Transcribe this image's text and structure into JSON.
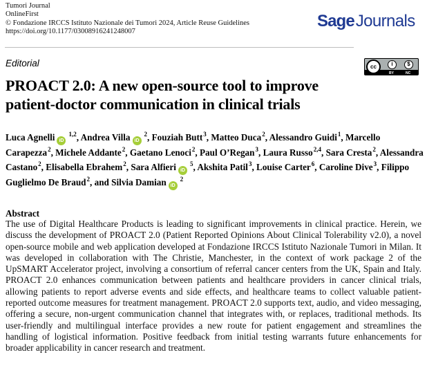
{
  "header": {
    "journal": "Tumori Journal",
    "status": "OnlineFirst",
    "copyright": "© Fondazione IRCCS Istituto Nazionale dei Tumori 2024, Article Reuse Guidelines",
    "doi": "https://doi.org/10.1177/03008916241248007",
    "brand_bold": "Sage",
    "brand_regular": "Journals",
    "brand_color": "#1f3a93"
  },
  "article": {
    "type": "Editorial",
    "license": {
      "icon": "cc-by-nc-icon",
      "cc": "cc",
      "by": "BY",
      "nc": "NC"
    },
    "title": "PROACT 2.0: A new open-source tool to improve patient-doctor communication in clinical trials",
    "orcid_label": "iD",
    "orcid_color": "#a6ce39",
    "authors": [
      {
        "name": "Luca Agnelli",
        "orcid": true,
        "aff": "1,2"
      },
      {
        "name": "Andrea Villa",
        "orcid": true,
        "aff": "2"
      },
      {
        "name": "Fouziah Butt",
        "orcid": false,
        "aff": "3"
      },
      {
        "name": "Matteo Duca",
        "orcid": false,
        "aff": "2"
      },
      {
        "name": "Alessandro Guidi",
        "orcid": false,
        "aff": "1"
      },
      {
        "name": "Marcello Carapezza",
        "orcid": false,
        "aff": "2"
      },
      {
        "name": "Michele Addante",
        "orcid": false,
        "aff": "2"
      },
      {
        "name": "Gaetano Lenoci",
        "orcid": false,
        "aff": "2"
      },
      {
        "name": "Paul O’Regan",
        "orcid": false,
        "aff": "3"
      },
      {
        "name": "Laura Russo",
        "orcid": false,
        "aff": "2,4"
      },
      {
        "name": "Sara Cresta",
        "orcid": false,
        "aff": "2"
      },
      {
        "name": "Alessandra Castano",
        "orcid": false,
        "aff": "2"
      },
      {
        "name": "Elisabella Ebrahem",
        "orcid": false,
        "aff": "2"
      },
      {
        "name": "Sara Alfieri",
        "orcid": true,
        "aff": "5"
      },
      {
        "name": "Akshita Patil",
        "orcid": false,
        "aff": "3"
      },
      {
        "name": "Louise Carter",
        "orcid": false,
        "aff": "6"
      },
      {
        "name": "Caroline Dive",
        "orcid": false,
        "aff": "3"
      },
      {
        "name": "Filippo Guglielmo De Braud",
        "orcid": false,
        "aff": "2"
      },
      {
        "name": "Silvia Damian",
        "orcid": true,
        "aff": "2"
      }
    ],
    "abstract_heading": "Abstract",
    "abstract": "The use of Digital Healthcare Products is leading to significant improvements in clinical practice. Herein, we discuss the development of PROACT 2.0 (Patient Reported Opinions About Clinical Tolerability v2.0), a novel open-source mobile and web application developed at Fondazione IRCCS Istituto Nazionale Tumori in Milan. It was developed in collaboration with The Christie, Manchester, in the context of work package 2 of the UpSMART Accelerator project, involving a consortium of referral cancer centers from the UK, Spain and Italy. PROACT 2.0 enhances communication between patients and healthcare providers in cancer clinical trials, allowing patients to report adverse events and side effects, and healthcare teams to collect valuable patient-reported outcome measures for treatment management. PROACT 2.0 supports text, audio, and video messaging, offering a secure, non-urgent communication channel that integrates with, or replaces, traditional methods. Its user-friendly and multilingual interface provides a new route for patient engagement and streamlines the handling of logistical information. Positive feedback from initial testing warrants future enhancements for broader applicability in cancer research and treatment."
  }
}
